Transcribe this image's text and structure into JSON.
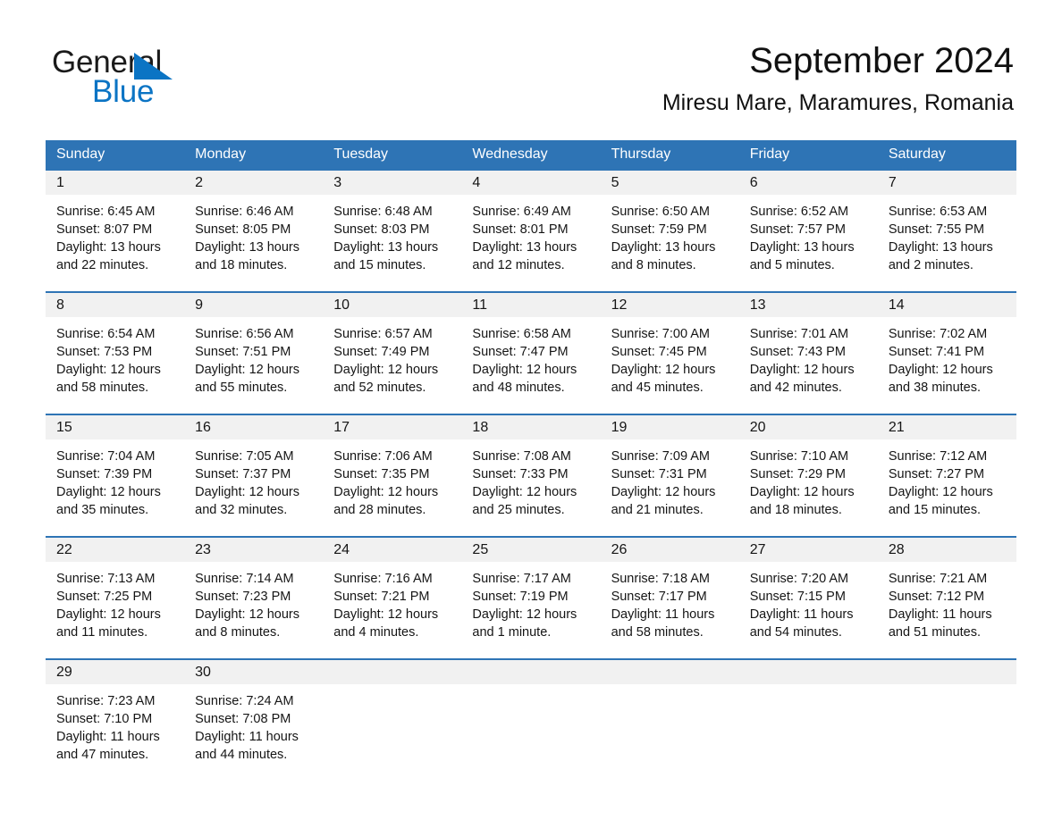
{
  "brand": {
    "name_part1": "General",
    "name_part2": "Blue",
    "triangle_icon": "triangle-right-icon",
    "accent_color": "#0b74c4"
  },
  "header": {
    "month_title": "September 2024",
    "location": "Miresu Mare, Maramures, Romania"
  },
  "calendar": {
    "header_bg_color": "#2e74b5",
    "daynum_bg_color": "#f1f1f1",
    "weekdays": [
      "Sunday",
      "Monday",
      "Tuesday",
      "Wednesday",
      "Thursday",
      "Friday",
      "Saturday"
    ],
    "weeks": [
      {
        "days": [
          {
            "number": "1",
            "sunrise": "Sunrise: 6:45 AM",
            "sunset": "Sunset: 8:07 PM",
            "daylight_line1": "Daylight: 13 hours",
            "daylight_line2": "and 22 minutes."
          },
          {
            "number": "2",
            "sunrise": "Sunrise: 6:46 AM",
            "sunset": "Sunset: 8:05 PM",
            "daylight_line1": "Daylight: 13 hours",
            "daylight_line2": "and 18 minutes."
          },
          {
            "number": "3",
            "sunrise": "Sunrise: 6:48 AM",
            "sunset": "Sunset: 8:03 PM",
            "daylight_line1": "Daylight: 13 hours",
            "daylight_line2": "and 15 minutes."
          },
          {
            "number": "4",
            "sunrise": "Sunrise: 6:49 AM",
            "sunset": "Sunset: 8:01 PM",
            "daylight_line1": "Daylight: 13 hours",
            "daylight_line2": "and 12 minutes."
          },
          {
            "number": "5",
            "sunrise": "Sunrise: 6:50 AM",
            "sunset": "Sunset: 7:59 PM",
            "daylight_line1": "Daylight: 13 hours",
            "daylight_line2": "and 8 minutes."
          },
          {
            "number": "6",
            "sunrise": "Sunrise: 6:52 AM",
            "sunset": "Sunset: 7:57 PM",
            "daylight_line1": "Daylight: 13 hours",
            "daylight_line2": "and 5 minutes."
          },
          {
            "number": "7",
            "sunrise": "Sunrise: 6:53 AM",
            "sunset": "Sunset: 7:55 PM",
            "daylight_line1": "Daylight: 13 hours",
            "daylight_line2": "and 2 minutes."
          }
        ]
      },
      {
        "days": [
          {
            "number": "8",
            "sunrise": "Sunrise: 6:54 AM",
            "sunset": "Sunset: 7:53 PM",
            "daylight_line1": "Daylight: 12 hours",
            "daylight_line2": "and 58 minutes."
          },
          {
            "number": "9",
            "sunrise": "Sunrise: 6:56 AM",
            "sunset": "Sunset: 7:51 PM",
            "daylight_line1": "Daylight: 12 hours",
            "daylight_line2": "and 55 minutes."
          },
          {
            "number": "10",
            "sunrise": "Sunrise: 6:57 AM",
            "sunset": "Sunset: 7:49 PM",
            "daylight_line1": "Daylight: 12 hours",
            "daylight_line2": "and 52 minutes."
          },
          {
            "number": "11",
            "sunrise": "Sunrise: 6:58 AM",
            "sunset": "Sunset: 7:47 PM",
            "daylight_line1": "Daylight: 12 hours",
            "daylight_line2": "and 48 minutes."
          },
          {
            "number": "12",
            "sunrise": "Sunrise: 7:00 AM",
            "sunset": "Sunset: 7:45 PM",
            "daylight_line1": "Daylight: 12 hours",
            "daylight_line2": "and 45 minutes."
          },
          {
            "number": "13",
            "sunrise": "Sunrise: 7:01 AM",
            "sunset": "Sunset: 7:43 PM",
            "daylight_line1": "Daylight: 12 hours",
            "daylight_line2": "and 42 minutes."
          },
          {
            "number": "14",
            "sunrise": "Sunrise: 7:02 AM",
            "sunset": "Sunset: 7:41 PM",
            "daylight_line1": "Daylight: 12 hours",
            "daylight_line2": "and 38 minutes."
          }
        ]
      },
      {
        "days": [
          {
            "number": "15",
            "sunrise": "Sunrise: 7:04 AM",
            "sunset": "Sunset: 7:39 PM",
            "daylight_line1": "Daylight: 12 hours",
            "daylight_line2": "and 35 minutes."
          },
          {
            "number": "16",
            "sunrise": "Sunrise: 7:05 AM",
            "sunset": "Sunset: 7:37 PM",
            "daylight_line1": "Daylight: 12 hours",
            "daylight_line2": "and 32 minutes."
          },
          {
            "number": "17",
            "sunrise": "Sunrise: 7:06 AM",
            "sunset": "Sunset: 7:35 PM",
            "daylight_line1": "Daylight: 12 hours",
            "daylight_line2": "and 28 minutes."
          },
          {
            "number": "18",
            "sunrise": "Sunrise: 7:08 AM",
            "sunset": "Sunset: 7:33 PM",
            "daylight_line1": "Daylight: 12 hours",
            "daylight_line2": "and 25 minutes."
          },
          {
            "number": "19",
            "sunrise": "Sunrise: 7:09 AM",
            "sunset": "Sunset: 7:31 PM",
            "daylight_line1": "Daylight: 12 hours",
            "daylight_line2": "and 21 minutes."
          },
          {
            "number": "20",
            "sunrise": "Sunrise: 7:10 AM",
            "sunset": "Sunset: 7:29 PM",
            "daylight_line1": "Daylight: 12 hours",
            "daylight_line2": "and 18 minutes."
          },
          {
            "number": "21",
            "sunrise": "Sunrise: 7:12 AM",
            "sunset": "Sunset: 7:27 PM",
            "daylight_line1": "Daylight: 12 hours",
            "daylight_line2": "and 15 minutes."
          }
        ]
      },
      {
        "days": [
          {
            "number": "22",
            "sunrise": "Sunrise: 7:13 AM",
            "sunset": "Sunset: 7:25 PM",
            "daylight_line1": "Daylight: 12 hours",
            "daylight_line2": "and 11 minutes."
          },
          {
            "number": "23",
            "sunrise": "Sunrise: 7:14 AM",
            "sunset": "Sunset: 7:23 PM",
            "daylight_line1": "Daylight: 12 hours",
            "daylight_line2": "and 8 minutes."
          },
          {
            "number": "24",
            "sunrise": "Sunrise: 7:16 AM",
            "sunset": "Sunset: 7:21 PM",
            "daylight_line1": "Daylight: 12 hours",
            "daylight_line2": "and 4 minutes."
          },
          {
            "number": "25",
            "sunrise": "Sunrise: 7:17 AM",
            "sunset": "Sunset: 7:19 PM",
            "daylight_line1": "Daylight: 12 hours",
            "daylight_line2": "and 1 minute."
          },
          {
            "number": "26",
            "sunrise": "Sunrise: 7:18 AM",
            "sunset": "Sunset: 7:17 PM",
            "daylight_line1": "Daylight: 11 hours",
            "daylight_line2": "and 58 minutes."
          },
          {
            "number": "27",
            "sunrise": "Sunrise: 7:20 AM",
            "sunset": "Sunset: 7:15 PM",
            "daylight_line1": "Daylight: 11 hours",
            "daylight_line2": "and 54 minutes."
          },
          {
            "number": "28",
            "sunrise": "Sunrise: 7:21 AM",
            "sunset": "Sunset: 7:12 PM",
            "daylight_line1": "Daylight: 11 hours",
            "daylight_line2": "and 51 minutes."
          }
        ]
      },
      {
        "days": [
          {
            "number": "29",
            "sunrise": "Sunrise: 7:23 AM",
            "sunset": "Sunset: 7:10 PM",
            "daylight_line1": "Daylight: 11 hours",
            "daylight_line2": "and 47 minutes."
          },
          {
            "number": "30",
            "sunrise": "Sunrise: 7:24 AM",
            "sunset": "Sunset: 7:08 PM",
            "daylight_line1": "Daylight: 11 hours",
            "daylight_line2": "and 44 minutes."
          },
          {
            "number": "",
            "sunrise": "",
            "sunset": "",
            "daylight_line1": "",
            "daylight_line2": ""
          },
          {
            "number": "",
            "sunrise": "",
            "sunset": "",
            "daylight_line1": "",
            "daylight_line2": ""
          },
          {
            "number": "",
            "sunrise": "",
            "sunset": "",
            "daylight_line1": "",
            "daylight_line2": ""
          },
          {
            "number": "",
            "sunrise": "",
            "sunset": "",
            "daylight_line1": "",
            "daylight_line2": ""
          },
          {
            "number": "",
            "sunrise": "",
            "sunset": "",
            "daylight_line1": "",
            "daylight_line2": ""
          }
        ]
      }
    ]
  }
}
